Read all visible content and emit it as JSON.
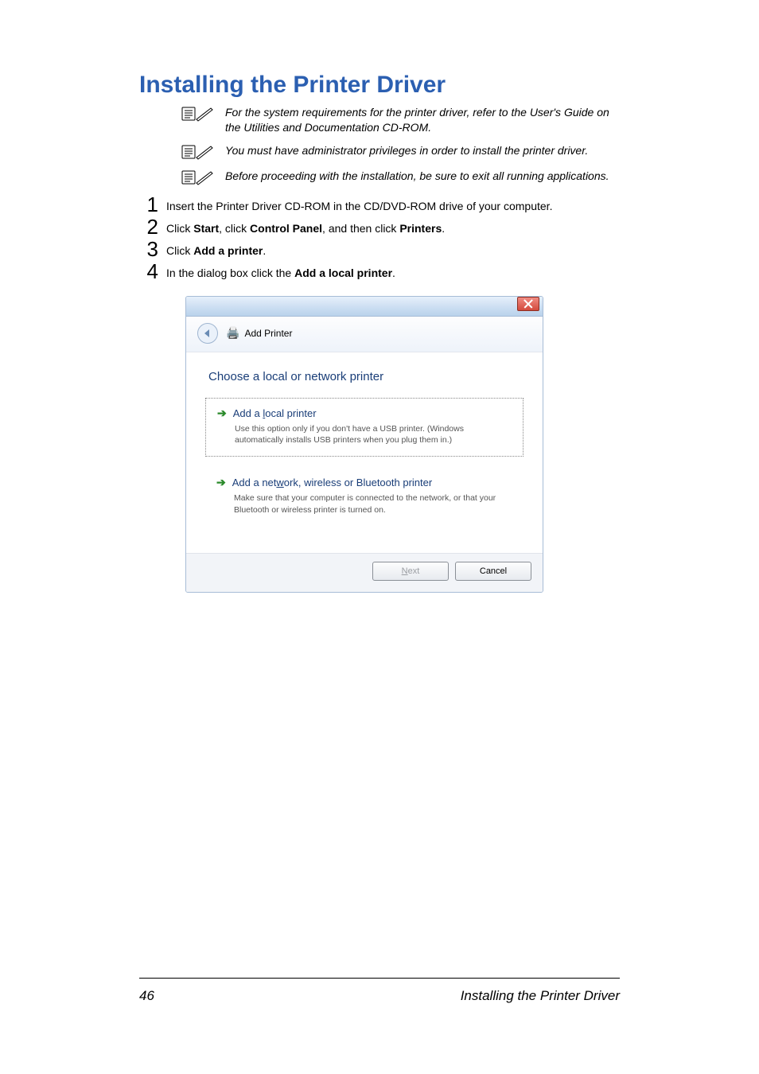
{
  "title": "Installing the Printer Driver",
  "notes": [
    "For the system requirements for the printer driver, refer to the User's Guide on the Utilities and Documentation CD-ROM.",
    "You must have administrator privileges in order to install the printer driver.",
    "Before proceeding with the installation, be sure to exit all running applications."
  ],
  "steps": [
    {
      "num": "1",
      "pre": "Insert the Printer Driver CD-ROM in the CD/DVD-ROM drive of your computer.",
      "parts": []
    },
    {
      "num": "2",
      "pre": "",
      "parts": [
        {
          "t": "Click ",
          "b": false
        },
        {
          "t": "Start",
          "b": true
        },
        {
          "t": ", click ",
          "b": false
        },
        {
          "t": "Control Panel",
          "b": true
        },
        {
          "t": ", and then click ",
          "b": false
        },
        {
          "t": "Printers",
          "b": true
        },
        {
          "t": ".",
          "b": false
        }
      ]
    },
    {
      "num": "3",
      "pre": "",
      "parts": [
        {
          "t": "Click ",
          "b": false
        },
        {
          "t": "Add a printer",
          "b": true
        },
        {
          "t": ".",
          "b": false
        }
      ]
    },
    {
      "num": "4",
      "pre": "",
      "parts": [
        {
          "t": "In the dialog box click the ",
          "b": false
        },
        {
          "t": "Add a local printer",
          "b": true
        },
        {
          "t": ".",
          "b": false
        }
      ]
    }
  ],
  "screenshot": {
    "wizard_title": "Add Printer",
    "heading": "Choose a local or network printer",
    "option1": {
      "title_pre": "Add a ",
      "title_u": "l",
      "title_post": "ocal printer",
      "desc": "Use this option only if you don't have a USB printer. (Windows automatically installs USB printers when you plug them in.)"
    },
    "option2": {
      "title_pre": "Add a net",
      "title_u": "w",
      "title_post": "ork, wireless or Bluetooth printer",
      "desc": "Make sure that your computer is connected to the network, or that your Bluetooth or wireless printer is turned on."
    },
    "btn_next_u": "N",
    "btn_next_rest": "ext",
    "btn_cancel": "Cancel"
  },
  "footer": {
    "page": "46",
    "running": "Installing the Printer Driver"
  }
}
